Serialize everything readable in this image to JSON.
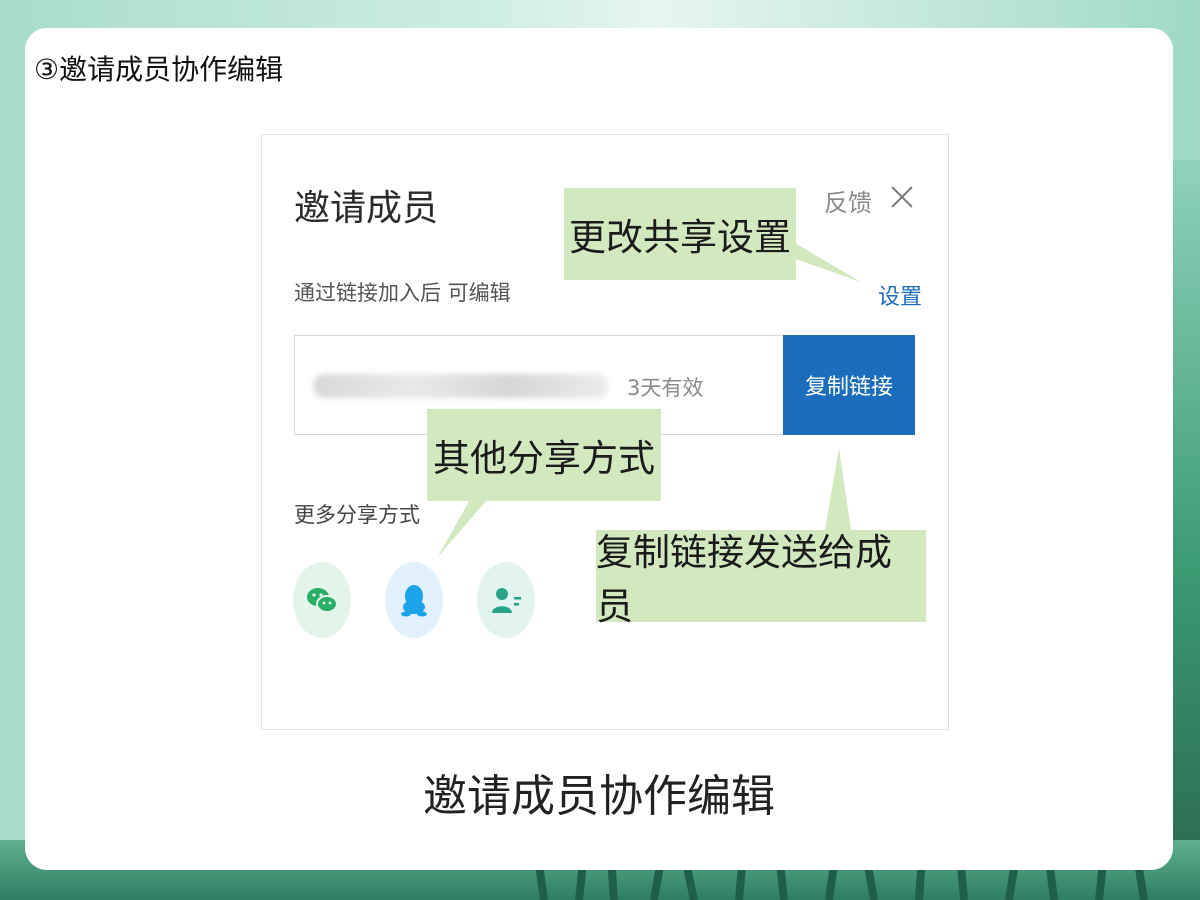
{
  "page": {
    "title": "③邀请成员协作编辑",
    "caption": "邀请成员协作编辑"
  },
  "dialog": {
    "title": "邀请成员",
    "feedback": "反馈",
    "permission_text": "通过链接加入后 可编辑",
    "settings_link": "设置",
    "link_validity": "3天有效",
    "copy_button": "复制链接",
    "more_share_label": "更多分享方式",
    "share_icons": [
      "wechat-icon",
      "qq-icon",
      "contact-icon"
    ]
  },
  "annotations": {
    "change_share_settings": "更改共享设置",
    "other_share_methods": "其他分享方式",
    "copy_link_send": "复制链接发送给成员"
  },
  "colors": {
    "primary_blue": "#1d6dbd",
    "callout_green": "#d2e9c0"
  }
}
